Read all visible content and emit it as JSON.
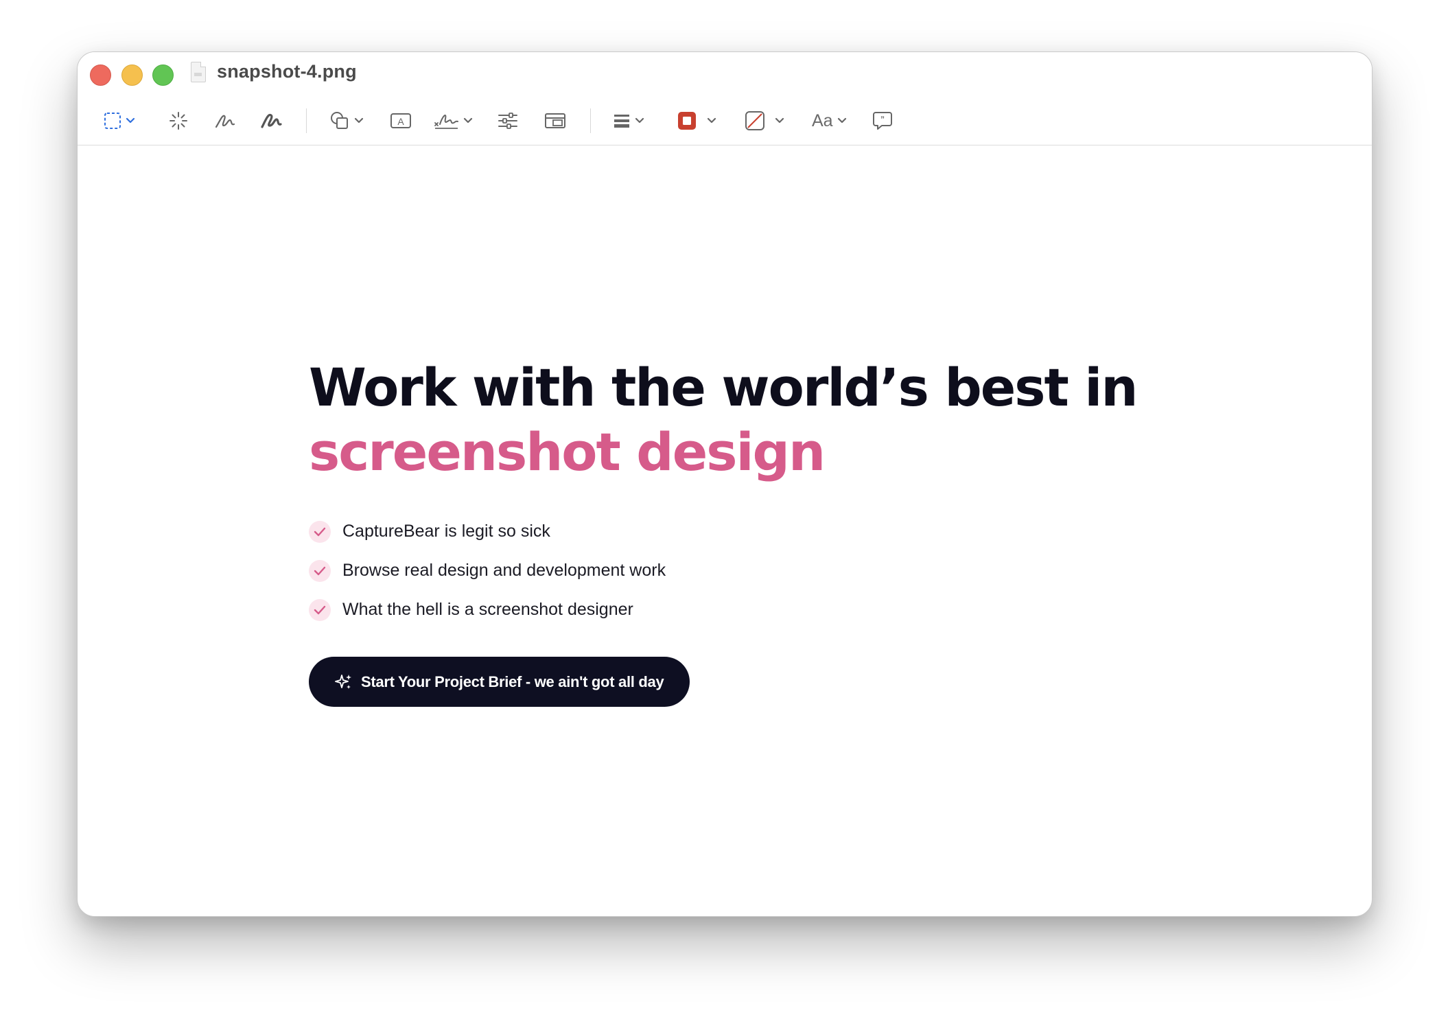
{
  "window": {
    "title": "snapshot-4.png"
  },
  "toolbar": {
    "items": [
      {
        "name": "rect-selection-icon",
        "has_menu": true,
        "color": "#2f6fde"
      },
      {
        "name": "instant-alpha-icon",
        "has_menu": false
      },
      {
        "name": "sketch-icon",
        "has_menu": false
      },
      {
        "name": "draw-icon",
        "has_menu": false
      },
      {
        "name": "shapes-icon",
        "has_menu": true
      },
      {
        "name": "text-box-icon",
        "has_menu": false
      },
      {
        "name": "signature-icon",
        "has_menu": true
      },
      {
        "name": "adjust-color-icon",
        "has_menu": false
      },
      {
        "name": "adjust-size-icon",
        "has_menu": false
      },
      {
        "name": "shape-style-icon",
        "has_menu": true
      },
      {
        "name": "border-color-icon",
        "has_menu": true,
        "color": "#c8402f"
      },
      {
        "name": "fill-color-icon",
        "has_menu": true
      },
      {
        "name": "text-style-icon",
        "has_menu": true
      },
      {
        "name": "note-icon",
        "has_menu": false
      }
    ],
    "text_style_label": "Aa"
  },
  "hero": {
    "headline_line1": "Work with the world’s best in",
    "headline_line2": "screenshot design",
    "accent_color": "#d65b8a",
    "features": [
      "CaptureBear is legit so sick",
      "Browse real design and development work",
      "What the hell is a screenshot designer"
    ],
    "cta_label": "Start Your Project Brief - we ain't got all day"
  }
}
